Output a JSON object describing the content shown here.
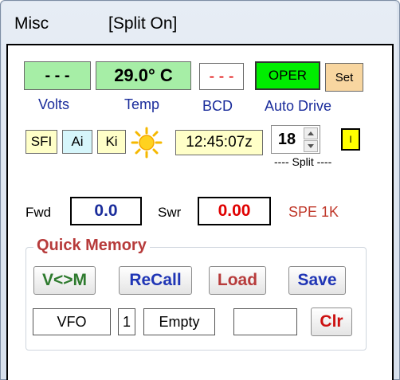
{
  "menu": {
    "misc": "Misc",
    "split_status": "[Split On]"
  },
  "top_row": {
    "volts_value": "- - -",
    "temp_value": "29.0° C",
    "bcd_value": "- - -",
    "oper_label": "OPER",
    "set_label": "Set"
  },
  "labels": {
    "volts": "Volts",
    "temp": "Temp",
    "bcd": "BCD",
    "auto_drive": "Auto Drive"
  },
  "second_row": {
    "sfi": "SFI",
    "ai": "Ai",
    "ki": "Ki",
    "time": "12:45:07z",
    "split_value": "18",
    "indicator": "I",
    "split_caption": "---- Split ----"
  },
  "meters": {
    "fwd_label": "Fwd",
    "fwd_value": "0.0",
    "swr_label": "Swr",
    "swr_value": "0.00",
    "amp_name": "SPE 1K"
  },
  "quick_memory": {
    "title": "Quick Memory",
    "buttons": {
      "vm": "V<>M",
      "recall": "ReCall",
      "load": "Load",
      "save": "Save",
      "clr": "Clr"
    },
    "vfo": "VFO",
    "slot": "1",
    "status": "Empty",
    "extra": ""
  },
  "colors": {
    "green_box": "#a6eea6",
    "oper_green": "#00ee00",
    "set_tan": "#f8d6a0",
    "yellow_box": "#ffffc8",
    "cyan_box": "#d6f6fb",
    "swr_red": "#e00000",
    "title_red": "#b73b3b",
    "blue_text": "#1a2c9b"
  }
}
